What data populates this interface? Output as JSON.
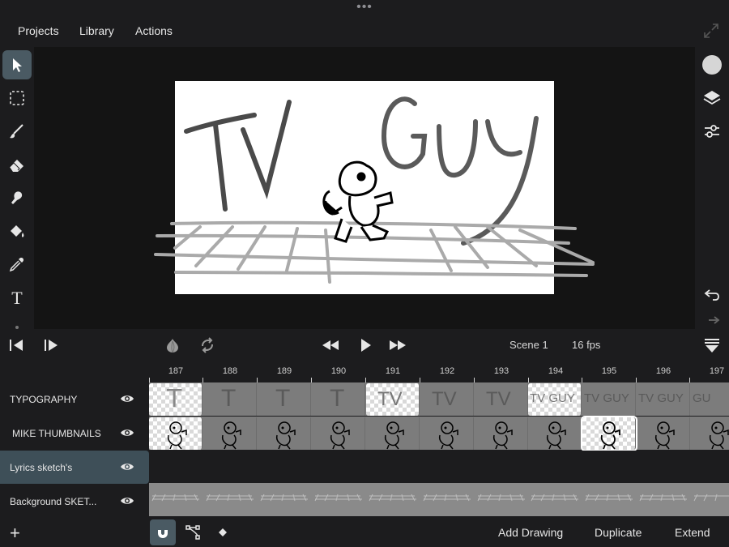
{
  "top_handle": "•••",
  "menu": {
    "projects": "Projects",
    "library": "Library",
    "actions": "Actions"
  },
  "left_tools": [
    "select-tool",
    "marquee-tool",
    "brush-tool",
    "eraser-tool",
    "smudge-tool",
    "fill-tool",
    "eyedropper-tool",
    "text-tool"
  ],
  "text_tool_glyph": "T",
  "canvas": {
    "title_left": "TV",
    "title_right": "GUY"
  },
  "transport": {
    "scene": "Scene 1",
    "fps": "16 fps"
  },
  "frames": [
    "187",
    "188",
    "189",
    "190",
    "191",
    "192",
    "193",
    "194",
    "195",
    "196",
    "197"
  ],
  "layers": [
    {
      "name": "TYPOGRAPHY",
      "selected": false
    },
    {
      "name": "MIKE THUMBNAILS",
      "selected": false
    },
    {
      "name": "Lyrics sketch's",
      "selected": true
    },
    {
      "name": "Background SKET...",
      "selected": false
    }
  ],
  "typography_cells": [
    "T",
    "T",
    "T",
    "T",
    "TV",
    "TV",
    "TV",
    "TV GUY",
    "TV GUY",
    "TV GUY",
    "GU"
  ],
  "bottom": {
    "add_layer": "+",
    "add_drawing": "Add Drawing",
    "duplicate": "Duplicate",
    "extend": "Extend"
  },
  "colors": {
    "accent": "#4a5a63",
    "current_color": "#d6d6d6"
  }
}
